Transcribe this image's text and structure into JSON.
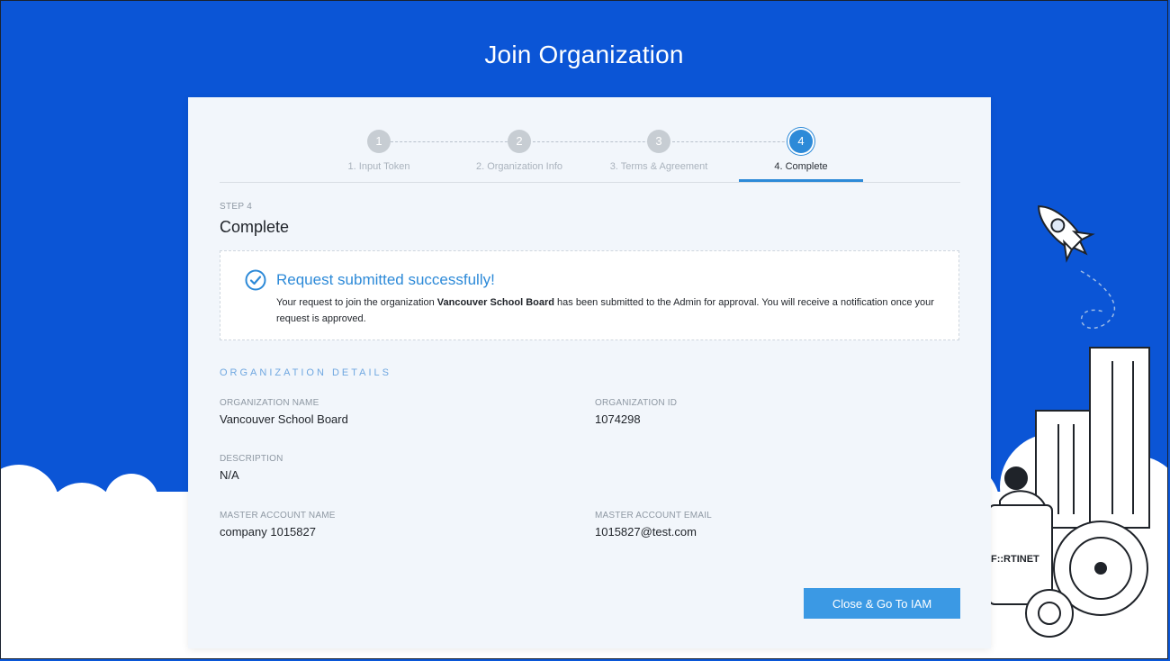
{
  "page": {
    "title": "Join Organization"
  },
  "stepper": {
    "steps": [
      {
        "number": "1",
        "label": "1. Input Token"
      },
      {
        "number": "2",
        "label": "2. Organization Info"
      },
      {
        "number": "3",
        "label": "3. Terms & Agreement"
      },
      {
        "number": "4",
        "label": "4. Complete"
      }
    ],
    "active_step": 4
  },
  "step": {
    "kicker": "STEP 4",
    "title": "Complete"
  },
  "success": {
    "title": "Request submitted successfully!",
    "text_before": "Your request to join the organization ",
    "org_name": "Vancouver School Board",
    "text_after": " has been submitted to the Admin for approval. You will receive a notification once your request is approved."
  },
  "details": {
    "heading": "ORGANIZATION DETAILS",
    "org_name_label": "ORGANIZATION NAME",
    "org_name_value": "Vancouver School Board",
    "org_id_label": "ORGANIZATION ID",
    "org_id_value": "1074298",
    "description_label": "DESCRIPTION",
    "description_value": "N/A",
    "master_name_label": "MASTER ACCOUNT NAME",
    "master_name_value": "company 1015827",
    "master_email_label": "MASTER ACCOUNT EMAIL",
    "master_email_value": "1015827@test.com"
  },
  "actions": {
    "close_label": "Close & Go To IAM"
  },
  "illustration": {
    "brand": "F::RTINET"
  },
  "colors": {
    "background": "#0b55d6",
    "accent": "#2d8ad8",
    "button": "#3b99e4"
  }
}
